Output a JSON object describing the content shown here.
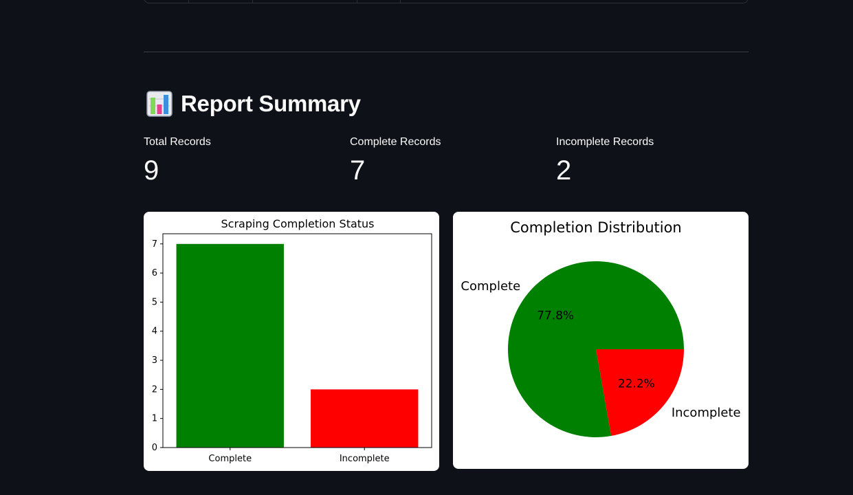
{
  "report": {
    "title": "Report Summary",
    "metrics": [
      {
        "label": "Total Records",
        "value": "9"
      },
      {
        "label": "Complete Records",
        "value": "7"
      },
      {
        "label": "Incomplete Records",
        "value": "2"
      }
    ]
  },
  "chart_data": [
    {
      "type": "bar",
      "title": "Scraping Completion Status",
      "categories": [
        "Complete",
        "Incomplete"
      ],
      "values": [
        7,
        2
      ],
      "colors": [
        "#008000",
        "#ff0000"
      ],
      "ylim": [
        0,
        7.35
      ],
      "yticks": [
        "0",
        "1",
        "2",
        "3",
        "4",
        "5",
        "6",
        "7"
      ],
      "xlabel": "",
      "ylabel": ""
    },
    {
      "type": "pie",
      "title": "Completion Distribution",
      "labels": [
        "Complete",
        "Incomplete"
      ],
      "values": [
        7,
        2
      ],
      "percent_labels": [
        "77.8%",
        "22.2%"
      ],
      "colors": [
        "#008000",
        "#ff0000"
      ]
    }
  ]
}
